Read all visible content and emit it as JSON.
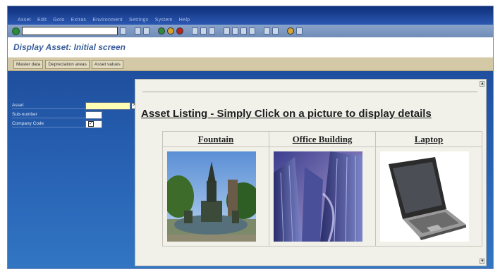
{
  "menu": {
    "items": [
      "Asset",
      "Edit",
      "Goto",
      "Extras",
      "Environment",
      "Settings",
      "System",
      "Help"
    ]
  },
  "toolbar": {
    "command_field_value": ""
  },
  "screen": {
    "title": "Display Asset: Initial screen"
  },
  "app_toolbar": {
    "buttons": [
      "Master data",
      "Depreciation areas",
      "Asset values"
    ]
  },
  "form": {
    "asset_label": "Asset",
    "asset_value": "",
    "sub_number_label": "Sub-number",
    "sub_number_value": "",
    "company_code_label": "Company Code",
    "company_code_value": ""
  },
  "panel": {
    "heading": "Asset Listing - Simply Click on a picture to display details",
    "assets": [
      {
        "name": "Fountain"
      },
      {
        "name": "Office Building"
      },
      {
        "name": "Laptop"
      }
    ]
  },
  "colors": {
    "frame_blue": "#1a3f8c",
    "title_blue": "#3a5d9a",
    "app_toolbar_tan": "#d4c9a6",
    "required_field_yellow": "#fffcb4",
    "panel_bg": "#f1f1ea"
  }
}
